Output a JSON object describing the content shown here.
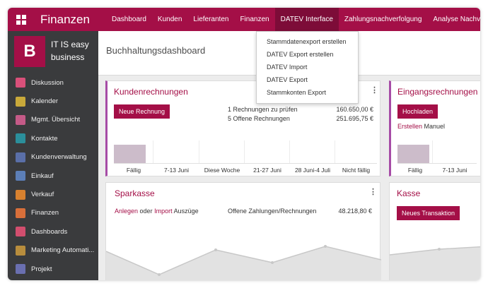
{
  "app": {
    "title": "Finanzen"
  },
  "menu": {
    "items": [
      {
        "label": "Dashboard"
      },
      {
        "label": "Kunden"
      },
      {
        "label": "Lieferanten"
      },
      {
        "label": "Finanzen"
      },
      {
        "label": "DATEV Interface"
      },
      {
        "label": "Zahlungsnachverfolgung"
      },
      {
        "label": "Analyse Nachverfolgung"
      }
    ],
    "active_index": 4
  },
  "dropdown": {
    "items": [
      {
        "label": "Stammdatenexport erstellen"
      },
      {
        "label": "DATEV Export erstellen"
      },
      {
        "label": "DATEV Import"
      },
      {
        "label": "DATEV Export"
      },
      {
        "label": "Stammkonten Export"
      }
    ]
  },
  "company": {
    "logo_letter": "B",
    "name": "IT IS easy business"
  },
  "sidebar": {
    "items": [
      {
        "label": "Diskussion",
        "icon": "chat-icon",
        "color": "#d9507a"
      },
      {
        "label": "Kalender",
        "icon": "calendar-icon",
        "color": "#c9a93a"
      },
      {
        "label": "Mgmt. Übersicht",
        "icon": "chart-icon",
        "color": "#c45a87"
      },
      {
        "label": "Kontakte",
        "icon": "contacts-icon",
        "color": "#2b8f9b"
      },
      {
        "label": "Kundenverwaltung",
        "icon": "handshake-icon",
        "color": "#5a6fa8"
      },
      {
        "label": "Einkauf",
        "icon": "purchase-icon",
        "color": "#5c7fb8"
      },
      {
        "label": "Verkauf",
        "icon": "sales-icon",
        "color": "#d8812f"
      },
      {
        "label": "Finanzen",
        "icon": "finance-icon",
        "color": "#d86f3a"
      },
      {
        "label": "Dashboards",
        "icon": "dashboard-icon",
        "color": "#d24e6e"
      },
      {
        "label": "Marketing Automati...",
        "icon": "marketing-icon",
        "color": "#b88d3d"
      },
      {
        "label": "Projekt",
        "icon": "project-icon",
        "color": "#6a6fb0"
      }
    ]
  },
  "page": {
    "title": "Buchhaltungsdashboard"
  },
  "kundenrechnungen": {
    "title": "Kundenrechnungen",
    "button": "Neue Rechnung",
    "stat1_label": "1 Rechnungen zu prüfen",
    "stat1_value": "160.650,00 €",
    "stat2_label": "5 Offene Rechnungen",
    "stat2_value": "251.695,75 €",
    "bars": [
      {
        "label": "Fällig",
        "value": 1
      },
      {
        "label": "7-13 Juni",
        "value": 0
      },
      {
        "label": "Diese Woche",
        "value": 0
      },
      {
        "label": "21-27 Juni",
        "value": 0
      },
      {
        "label": "28 Juni-4 Juli",
        "value": 0
      },
      {
        "label": "Nicht fällig",
        "value": 0
      }
    ]
  },
  "eingangsrechnungen": {
    "title": "Eingangsrechnungen",
    "button": "Hochladen",
    "link": "Erstellen",
    "text": "Manuel",
    "bars": [
      {
        "label": "Fällig",
        "value": 1
      },
      {
        "label": "7-13 Juni",
        "value": 0
      }
    ]
  },
  "sparkasse": {
    "title": "Sparkasse",
    "link1": "Anlegen",
    "word1": "oder",
    "link2": "Import",
    "word2": "Auszüge",
    "stat_label": "Offene Zahlungen/Rechnungen",
    "stat_value": "48.218,80 €"
  },
  "kasse": {
    "title": "Kasse",
    "button": "Neues Transaktion"
  },
  "colors": {
    "brand": "#a40f47",
    "sidebar": "#3a3b3d",
    "accent": "#a64ca6"
  }
}
